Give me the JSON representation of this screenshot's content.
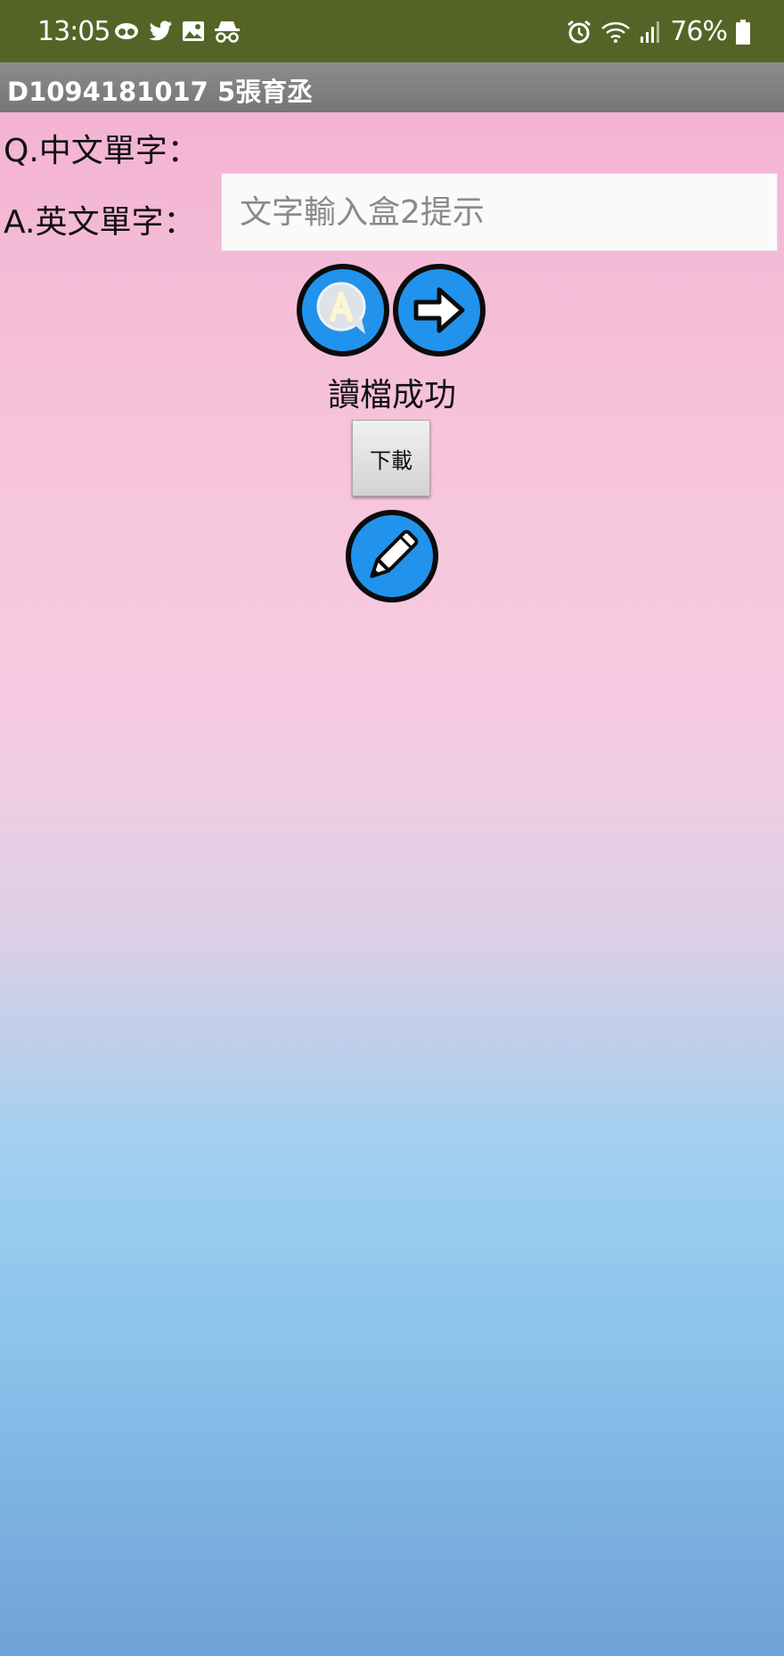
{
  "status_bar": {
    "time": "13:05",
    "battery": "76%",
    "icons": [
      "spy-app-icon",
      "twitter-icon",
      "image-icon",
      "incognito-icon",
      "alarm-icon",
      "wifi-icon",
      "signal-icon",
      "battery-icon"
    ]
  },
  "app_bar": {
    "title": "D1094181017 5張育丞"
  },
  "question": {
    "label": "Q.中文單字："
  },
  "answer": {
    "label": "A.英文單字：",
    "placeholder": "文字輸入盒2提示",
    "value": ""
  },
  "buttons": {
    "speak_icon": "speech-bubble-a-icon",
    "next_icon": "arrow-right-icon",
    "download_label": "下載",
    "edit_icon": "pencil-icon"
  },
  "message": {
    "text": "讀檔成功"
  },
  "colors": {
    "status_bar": "#556426",
    "app_bar": "#808080",
    "button_blue": "#2193ec",
    "gradient_top": "#f2aed0",
    "gradient_bottom": "#6fa2d6"
  }
}
